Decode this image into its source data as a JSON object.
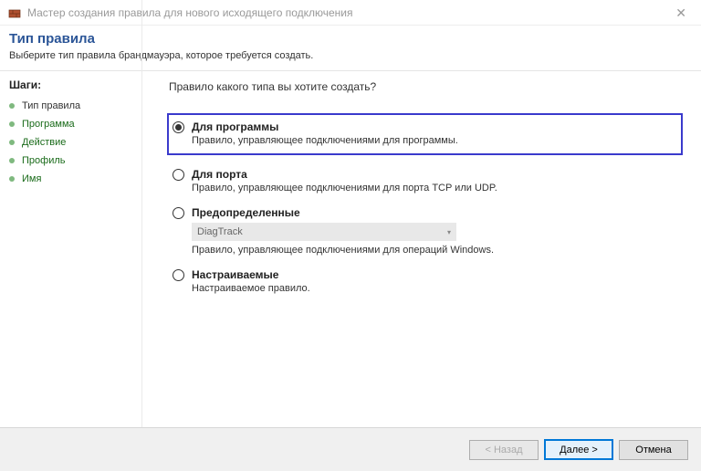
{
  "window": {
    "title": "Мастер создания правила для нового исходящего подключения"
  },
  "header": {
    "title": "Тип правила",
    "subtitle": "Выберите тип правила брандмауэра, которое требуется создать."
  },
  "sidebar": {
    "heading": "Шаги:",
    "items": [
      {
        "label": "Тип правила",
        "state": "current"
      },
      {
        "label": "Программа",
        "state": "upcoming"
      },
      {
        "label": "Действие",
        "state": "upcoming"
      },
      {
        "label": "Профиль",
        "state": "upcoming"
      },
      {
        "label": "Имя",
        "state": "upcoming"
      }
    ]
  },
  "main": {
    "question": "Правило какого типа вы хотите создать?",
    "options": [
      {
        "label": "Для программы",
        "desc": "Правило, управляющее подключениями для программы.",
        "checked": true,
        "highlighted": true
      },
      {
        "label": "Для порта",
        "desc": "Правило, управляющее подключениями для порта TCP или UDP.",
        "checked": false
      },
      {
        "label": "Предопределенные",
        "desc": "Правило, управляющее подключениями для операций Windows.",
        "checked": false,
        "dropdown": "DiagTrack"
      },
      {
        "label": "Настраиваемые",
        "desc": "Настраиваемое правило.",
        "checked": false
      }
    ]
  },
  "footer": {
    "back": "< Назад",
    "next": "Далее >",
    "cancel": "Отмена"
  }
}
